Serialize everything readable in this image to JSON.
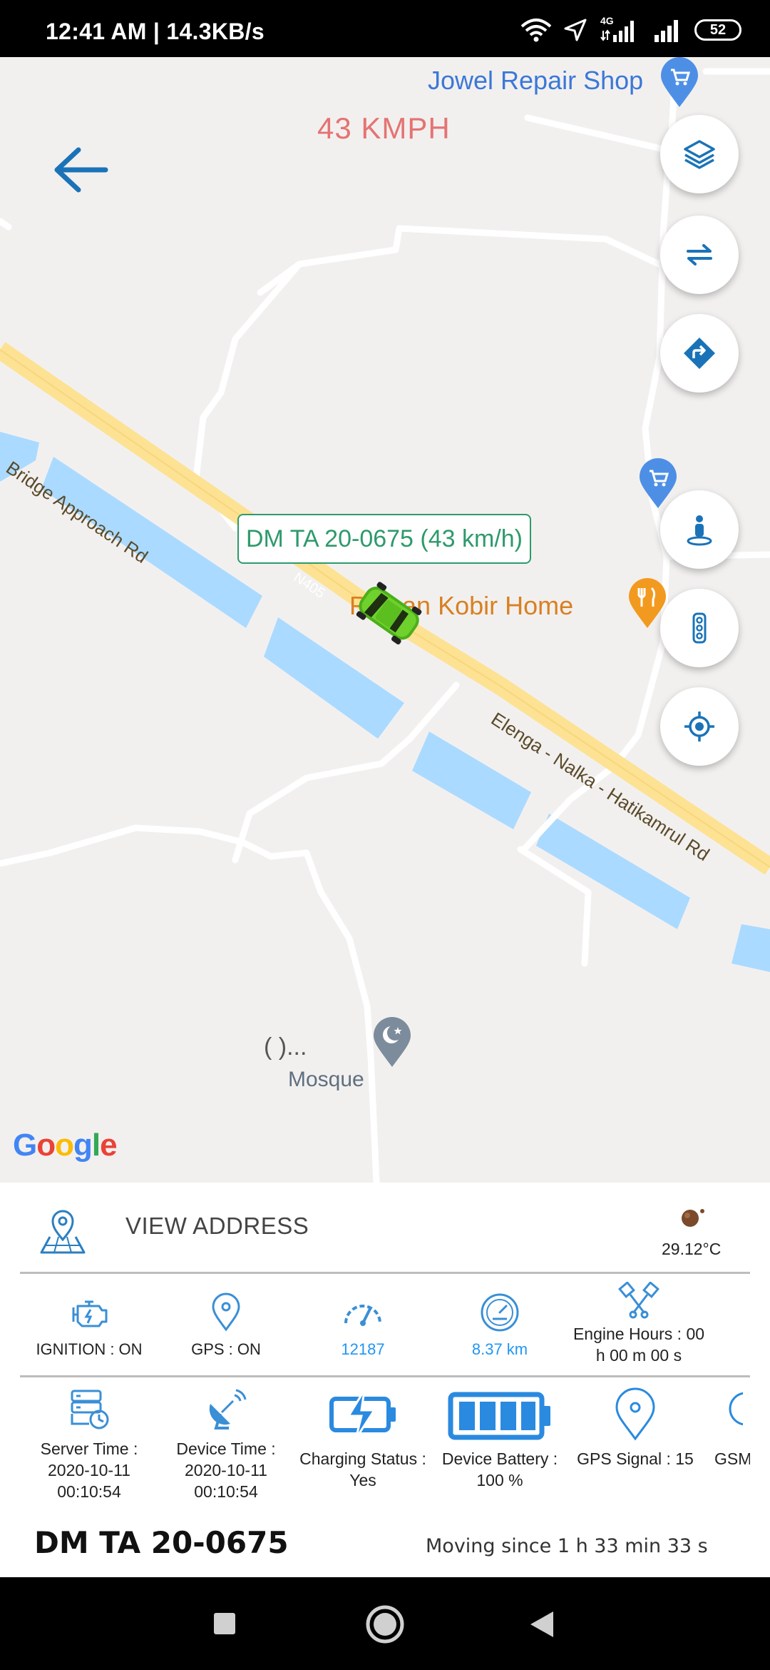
{
  "status_bar": {
    "time": "12:41 AM | 14.3KB/s",
    "network": "4G",
    "battery": "52"
  },
  "map": {
    "speed_title": "43 KMPH",
    "vehicle_label": "DM TA 20-0675 (43 km/h)",
    "road_labels": {
      "bridge_road": "Bridge Approach Rd",
      "main_road": "Elenga - Nalka - Hatikamrul Rd",
      "road_number": "N405"
    },
    "places": {
      "repair_shop": "Jowel Repair Shop",
      "home": "Rajhan Kobir Home",
      "mosque_name": "(          )...",
      "mosque": "Mosque"
    },
    "logo": [
      "G",
      "o",
      "o",
      "g",
      "l",
      "e"
    ],
    "colors": {
      "map_bg": "#f2f0ef",
      "water": "#aadaff",
      "main_road": "#fde293",
      "accent": "#1a73b8"
    }
  },
  "panel": {
    "view_address": "VIEW ADDRESS",
    "temperature": "29.12°C",
    "row1": [
      {
        "icon": "engine-icon",
        "label": "IGNITION : ON"
      },
      {
        "icon": "gps-pin-icon",
        "label": "GPS : ON"
      },
      {
        "icon": "speedometer-icon",
        "label": "12187"
      },
      {
        "icon": "gauge-icon",
        "label": "8.37 km"
      },
      {
        "icon": "pistons-icon",
        "label": "Engine Hours : 00 h 00 m 00 s"
      }
    ],
    "row2": [
      {
        "icon": "server-time-icon",
        "label": "Server Time : 2020-10-11 00:10:54"
      },
      {
        "icon": "satellite-dish-icon",
        "label": "Device Time : 2020-10-11 00:10:54"
      },
      {
        "icon": "charging-battery-icon",
        "label": "Charging Status : Yes"
      },
      {
        "icon": "full-battery-icon",
        "label": "Device Battery : 100 %"
      },
      {
        "icon": "location-pin-icon",
        "label": "GPS Signal : 15"
      },
      {
        "icon": "gsm-icon",
        "label": "GSM"
      }
    ],
    "plate": "DM TA 20-0675",
    "moving_since": "Moving since 1 h 33 min 33 s"
  }
}
